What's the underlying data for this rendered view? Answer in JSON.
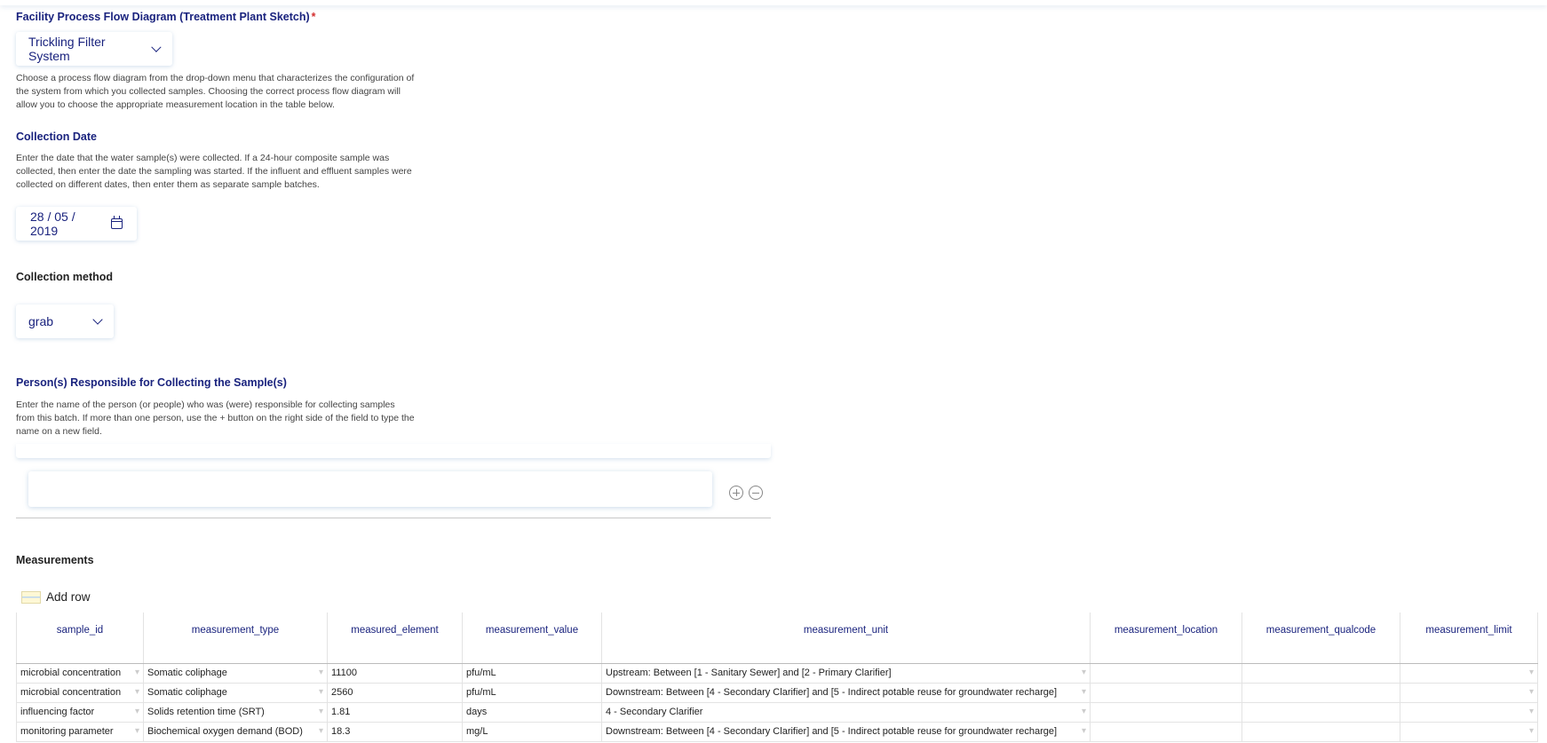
{
  "flow_diagram": {
    "label": "Facility Process Flow Diagram (Treatment Plant Sketch)",
    "required_mark": "*",
    "selected": "Trickling Filter System",
    "help": "Choose a process flow diagram from the drop-down menu that characterizes the configuration of the system from which you collected samples. Choosing the correct process flow diagram will allow you to choose the appropriate measurement location in the table below."
  },
  "collection_date": {
    "label": "Collection Date",
    "help": "Enter the date that the water sample(s) were collected. If a 24-hour composite sample was collected, then enter the date the sampling was started. If the influent and effluent samples were collected on different dates, then enter them as separate sample batches.",
    "value": "28 / 05 / 2019"
  },
  "collection_method": {
    "label": "Collection method",
    "selected": "grab"
  },
  "persons": {
    "label": "Person(s) Responsible for Collecting the Sample(s)",
    "help": "Enter the name of the person (or people) who was (were) responsible for collecting samples from this batch. If more than one person, use the + button on the right side of the field to type the name on a new field.",
    "value": ""
  },
  "measurements": {
    "label": "Measurements",
    "add_row": "Add row",
    "columns": [
      "sample_id",
      "measurement_type",
      "measured_element",
      "measurement_value",
      "measurement_unit",
      "measurement_location",
      "measurement_qualcode",
      "measurement_limit"
    ],
    "rows": [
      [
        "microbial concentration",
        "Somatic coliphage",
        "11100",
        "pfu/mL",
        "Upstream: Between [1 - Sanitary Sewer] and [2 - Primary Clarifier]",
        "",
        "",
        ""
      ],
      [
        "microbial concentration",
        "Somatic coliphage",
        "2560",
        "pfu/mL",
        "Downstream: Between [4 - Secondary Clarifier] and [5 - Indirect potable reuse for groundwater recharge]",
        "",
        "",
        ""
      ],
      [
        "influencing factor",
        "Solids retention time (SRT)",
        "1.81",
        "days",
        "4 - Secondary Clarifier",
        "",
        "",
        ""
      ],
      [
        "monitoring parameter",
        "Biochemical oxygen demand (BOD)",
        "18.3",
        "mg/L",
        "Downstream: Between [4 - Secondary Clarifier] and [5 - Indirect potable reuse for groundwater recharge]",
        "",
        "",
        ""
      ]
    ]
  },
  "colors": {
    "label": "#1a237e",
    "required": "#d32f2f",
    "border": "#e3e3e3"
  }
}
